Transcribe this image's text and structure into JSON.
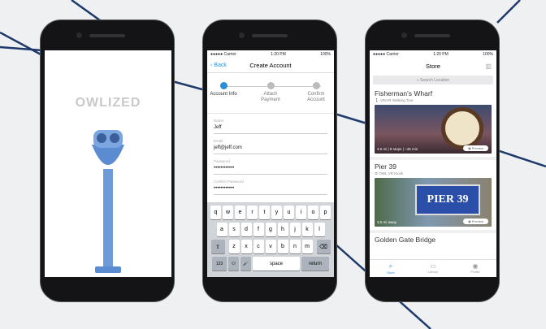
{
  "status": {
    "carrier": "●●●●● Carrier",
    "time": "1:20 PM",
    "battery": "100%"
  },
  "splash": {
    "logo": "OWLIZED"
  },
  "create": {
    "back": "Back",
    "title": "Create Account",
    "steps": [
      {
        "label": "Account Info",
        "active": true
      },
      {
        "label": "Attach Payment",
        "active": false
      },
      {
        "label": "Confirm Account",
        "active": false
      }
    ],
    "fields": [
      {
        "label": "Name",
        "value": "Jeff"
      },
      {
        "label": "Email",
        "value": "jeff@jeff.com"
      },
      {
        "label": "Password",
        "value": "••••••••••••"
      },
      {
        "label": "Confirm Password",
        "value": "••••••••••••"
      }
    ],
    "keyboard": {
      "row1": [
        "q",
        "w",
        "e",
        "r",
        "t",
        "y",
        "u",
        "i",
        "o",
        "p"
      ],
      "row2": [
        "a",
        "s",
        "d",
        "f",
        "g",
        "h",
        "j",
        "k",
        "l"
      ],
      "row3": [
        "z",
        "x",
        "c",
        "v",
        "b",
        "n",
        "m"
      ],
      "shift": "⇧",
      "delete": "⌫",
      "num": "123",
      "emoji": "☺",
      "mic": "🎤",
      "space": "space",
      "return": "return"
    }
  },
  "store": {
    "title": "Store",
    "search_placeholder": "Search Location",
    "cards": [
      {
        "title": "Fisherman's Wharf",
        "subtitle": "VR/AR Walking Tour",
        "meta": "3.5 mi | 8 stops | ~45 min",
        "preview": "Preview"
      },
      {
        "title": "Pier 39",
        "subtitle": "OWL VR Kiosk",
        "meta": "3.5 mi away",
        "preview": "Preview"
      },
      {
        "title": "Golden Gate Bridge"
      }
    ],
    "tabs": [
      {
        "label": "Store",
        "icon": "search-icon"
      },
      {
        "label": "Library",
        "icon": "library-icon"
      },
      {
        "label": "Profile",
        "icon": "profile-icon"
      }
    ]
  },
  "colors": {
    "accent": "#2a8fd9",
    "lines": "#1d3a6b"
  }
}
